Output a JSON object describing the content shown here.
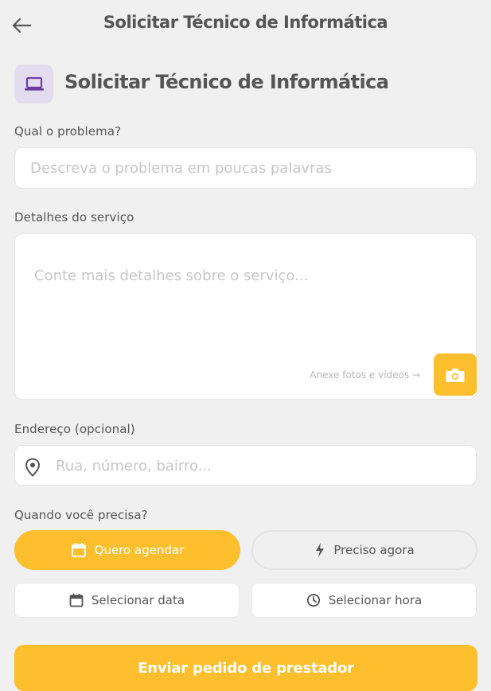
{
  "header": {
    "title": "Solicitar Técnico de Informática",
    "back_icon": "arrow-left-icon"
  },
  "hero": {
    "title": "Solicitar Técnico de Informática",
    "icon": "laptop-icon",
    "icon_color": "#6a3fa0",
    "icon_bg": "#e3dcef"
  },
  "problem": {
    "label": "Qual o problema?",
    "placeholder": "Descreva o problema em poucas palavras",
    "value": ""
  },
  "details": {
    "label": "Detalhes do serviço",
    "placeholder": "Conte mais detalhes sobre o serviço...",
    "value": "",
    "attach_hint": "Anexe fotos e vídeos →",
    "camera_icon": "camera-icon"
  },
  "address": {
    "label": "Endereço (opcional)",
    "placeholder": "Rua, número, bairro...",
    "value": "",
    "icon": "map-pin-icon"
  },
  "when": {
    "label": "Quando você precisa?",
    "options": [
      {
        "label": "Quero agendar",
        "icon": "calendar-icon",
        "selected": true
      },
      {
        "label": "Preciso agora",
        "icon": "lightning-icon",
        "selected": false
      }
    ],
    "date_picker": {
      "label": "Selecionar data",
      "icon": "calendar-icon"
    },
    "time_picker": {
      "label": "Selecionar hora",
      "icon": "clock-icon"
    }
  },
  "submit": {
    "label": "Enviar pedido de prestador"
  },
  "colors": {
    "accent": "#fdbf2d",
    "background": "#f0f0f0",
    "text": "#555555",
    "placeholder": "#c7c7c7"
  }
}
